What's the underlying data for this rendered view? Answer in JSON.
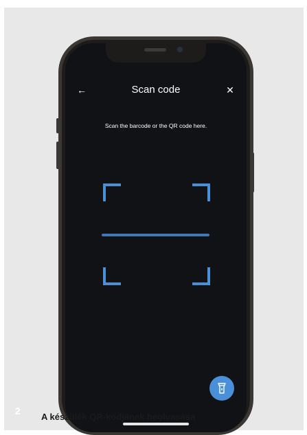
{
  "screen": {
    "title": "Scan code",
    "back_icon": "arrow-left-icon",
    "back_glyph": "←",
    "close_icon": "close-icon",
    "close_glyph": "✕",
    "instruction": "Scan the barcode or the QR code here.",
    "flashlight_icon": "flashlight-icon"
  },
  "caption": {
    "step_number": "2",
    "text": "A készülék QR-kódjának beolvasása"
  },
  "colors": {
    "accent": "#4a90d9",
    "screen_bg": "#101216",
    "panel_bg": "#e8e8e8"
  }
}
